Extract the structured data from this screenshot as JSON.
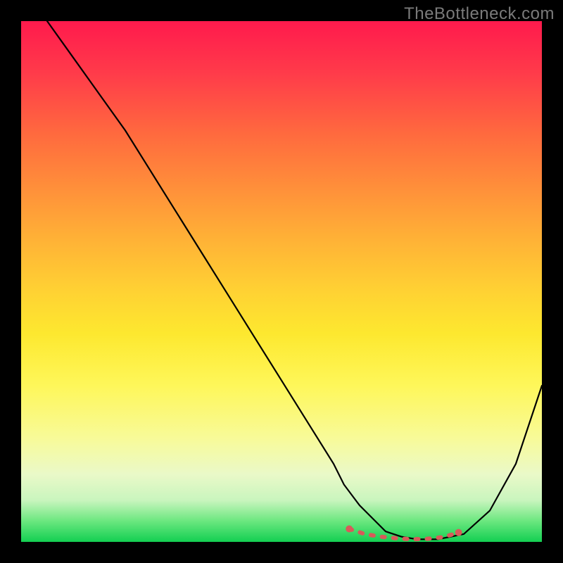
{
  "watermark": "TheBottleneck.com",
  "colors": {
    "background": "#000000",
    "curve": "#000000",
    "dots": "#d85a5a"
  },
  "chart_data": {
    "type": "line",
    "title": "",
    "xlabel": "",
    "ylabel": "",
    "xlim": [
      0,
      100
    ],
    "ylim": [
      0,
      100
    ],
    "grid": false,
    "legend": false,
    "annotations": [
      "TheBottleneck.com"
    ],
    "series": [
      {
        "name": "bottleneck-curve",
        "x": [
          5,
          10,
          15,
          20,
          25,
          30,
          35,
          40,
          45,
          50,
          55,
          60,
          62,
          65,
          68,
          70,
          73,
          76,
          80,
          85,
          90,
          95,
          100
        ],
        "y": [
          100,
          93,
          86,
          79,
          71,
          63,
          55,
          47,
          39,
          31,
          23,
          15,
          11,
          7,
          4,
          2,
          1,
          0.5,
          0.5,
          1.5,
          6,
          15,
          30
        ]
      }
    ],
    "highlight": {
      "name": "optimal-range-dots",
      "x": [
        63,
        66,
        69,
        72,
        75,
        78,
        81,
        84
      ],
      "y": [
        2.5,
        1.5,
        1,
        0.7,
        0.5,
        0.6,
        0.9,
        1.8
      ]
    }
  }
}
